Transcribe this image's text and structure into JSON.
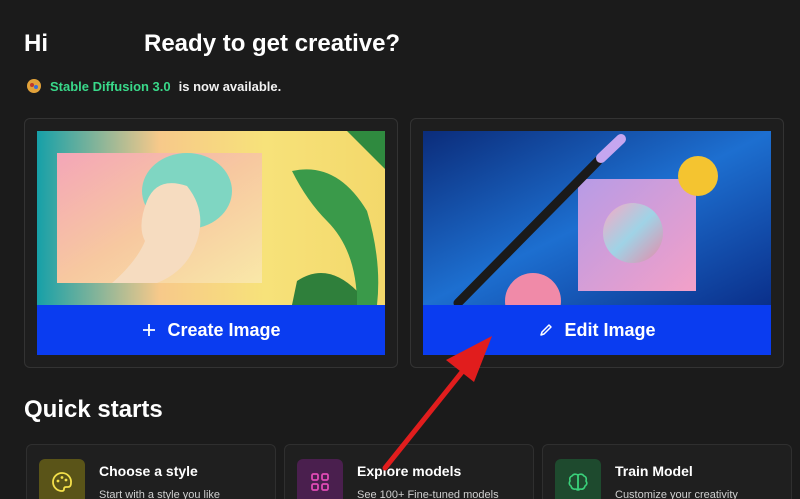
{
  "greeting": {
    "hi": "Hi",
    "ready": "Ready to get creative?"
  },
  "announcement": {
    "icon": "rocket-emoji-icon",
    "model": "Stable Diffusion 3.0",
    "rest": "is now available."
  },
  "cards": {
    "create": {
      "label": "Create Image",
      "icon": "plus-icon"
    },
    "edit": {
      "label": "Edit Image",
      "icon": "pencil-icon"
    }
  },
  "quick_starts": {
    "title": "Quick starts",
    "items": [
      {
        "title": "Choose a style",
        "desc": "Start with a style you like",
        "icon": "palette-icon",
        "color": "#5a5418"
      },
      {
        "title": "Explore models",
        "desc": "See 100+ Fine-tuned models",
        "icon": "grid-icon",
        "color": "#4a1f4e"
      },
      {
        "title": "Train Model",
        "desc": "Customize your creativity",
        "icon": "brain-icon",
        "color": "#1e4a2e"
      }
    ]
  },
  "colors": {
    "accent": "#0a3cf0",
    "model_highlight": "#39d98a",
    "annotation_arrow": "#e11d1d"
  }
}
